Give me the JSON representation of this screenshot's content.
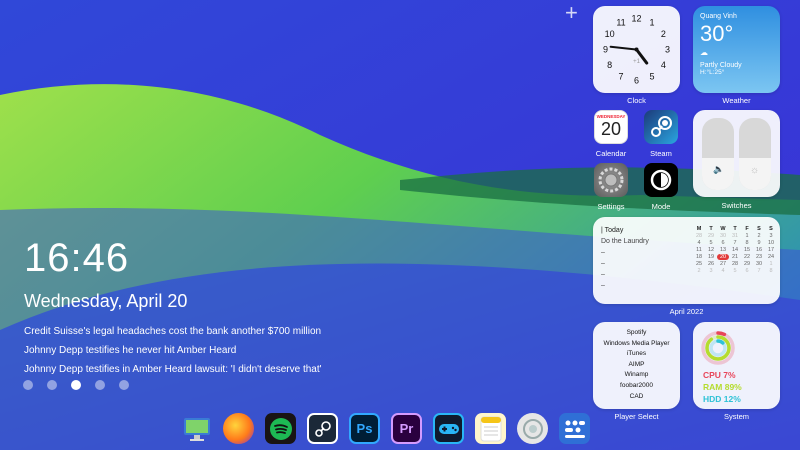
{
  "left": {
    "time": "16:46",
    "date": "Wednesday, April 20",
    "news": [
      "Credit Suisse's legal headaches cost the bank another $700 million",
      "Johnny Depp testifies he never hit Amber Heard",
      "Johnny Depp testifies in Amber Heard lawsuit: 'I didn't deserve that'"
    ],
    "page_dots": 5,
    "active_dot": 2
  },
  "add_icon": "+",
  "widgets": {
    "clock": {
      "label": "Clock",
      "numbers": [
        "12",
        "1",
        "2",
        "3",
        "4",
        "5",
        "6",
        "7",
        "8",
        "9",
        "10",
        "11"
      ],
      "offset": "+1",
      "hour": 4,
      "minute": 46
    },
    "weather": {
      "label": "Weather",
      "location": "Quang Vinh",
      "temp": "30°",
      "condition": "Partly Cloudy",
      "hilo": "H:°L:25°"
    },
    "calendar_app": {
      "label": "Calendar",
      "month": "WEDNESDAY",
      "day": "20"
    },
    "steam_app": {
      "label": "Steam"
    },
    "settings_app": {
      "label": "Settings"
    },
    "mode_app": {
      "label": "Mode"
    },
    "switches": {
      "label": "Switches",
      "volume_level": 0.45,
      "brightness_level": 0.45
    },
    "todo": {
      "label": "April 2022",
      "header": "| Today",
      "items": [
        "Do the Laundry",
        "–",
        "–",
        "–",
        "–"
      ],
      "weekdays": [
        "M",
        "T",
        "W",
        "T",
        "F",
        "S",
        "S"
      ],
      "weeks": [
        [
          "28",
          "29",
          "30",
          "31",
          "1",
          "2",
          "3"
        ],
        [
          "4",
          "5",
          "6",
          "7",
          "8",
          "9",
          "10"
        ],
        [
          "11",
          "12",
          "13",
          "14",
          "15",
          "16",
          "17"
        ],
        [
          "18",
          "19",
          "20",
          "21",
          "22",
          "23",
          "24"
        ],
        [
          "25",
          "26",
          "27",
          "28",
          "29",
          "30",
          "1"
        ],
        [
          "2",
          "3",
          "4",
          "5",
          "6",
          "7",
          "8"
        ]
      ],
      "today": "20"
    },
    "player": {
      "label": "Player Select",
      "options": [
        "Spotify",
        "Windows Media Player",
        "iTunes",
        "AIMP",
        "Winamp",
        "foobar2000",
        "CAD"
      ]
    },
    "system": {
      "label": "System",
      "cpu": "CPU 7%",
      "ram": "RAM 89%",
      "hdd": "HDD 12%",
      "cpu_pct": 7,
      "ram_pct": 89,
      "hdd_pct": 12
    }
  },
  "dock": [
    {
      "name": "monitor",
      "bg": "#3a7bd5"
    },
    {
      "name": "firefox",
      "bg": "#ff7a1a"
    },
    {
      "name": "spotify",
      "bg": "#191414"
    },
    {
      "name": "steam",
      "bg": "#1b2838"
    },
    {
      "name": "photoshop",
      "bg": "#001e36",
      "text": "Ps"
    },
    {
      "name": "premiere",
      "bg": "#2a003f",
      "text": "Pr"
    },
    {
      "name": "gamepad",
      "bg": "#0f1a2e"
    },
    {
      "name": "notes",
      "bg": "#fff6cc"
    },
    {
      "name": "settings-circle",
      "bg": "#e6e6e6"
    },
    {
      "name": "control-panel",
      "bg": "#2f6fd6"
    }
  ]
}
